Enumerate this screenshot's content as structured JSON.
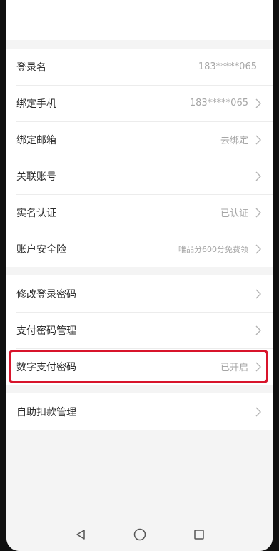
{
  "account": {
    "rows": [
      {
        "label": "登录名",
        "value": "183*****065"
      },
      {
        "label": "绑定手机",
        "value": "183*****065"
      },
      {
        "label": "绑定邮箱",
        "value": "去绑定"
      },
      {
        "label": "关联账号",
        "value": ""
      },
      {
        "label": "实名认证",
        "value": "已认证"
      },
      {
        "label": "账户安全险",
        "value": "唯品分600分免费领"
      }
    ]
  },
  "security": {
    "rows": [
      {
        "label": "修改登录密码",
        "value": ""
      },
      {
        "label": "支付密码管理",
        "value": ""
      },
      {
        "label": "数字支付密码",
        "value": "已开启"
      }
    ]
  },
  "autopay": {
    "rows": [
      {
        "label": "自助扣款管理",
        "value": ""
      }
    ]
  },
  "colors": {
    "highlight": "#d8142b",
    "background": "#f4f4f4",
    "text": "#2b2b2b",
    "muted": "#a6a6a6"
  },
  "icons": {
    "row_arrow": "chevron-right-icon",
    "nav_back": "back-triangle-icon",
    "nav_home": "home-circle-icon",
    "nav_recent": "recent-square-icon"
  }
}
